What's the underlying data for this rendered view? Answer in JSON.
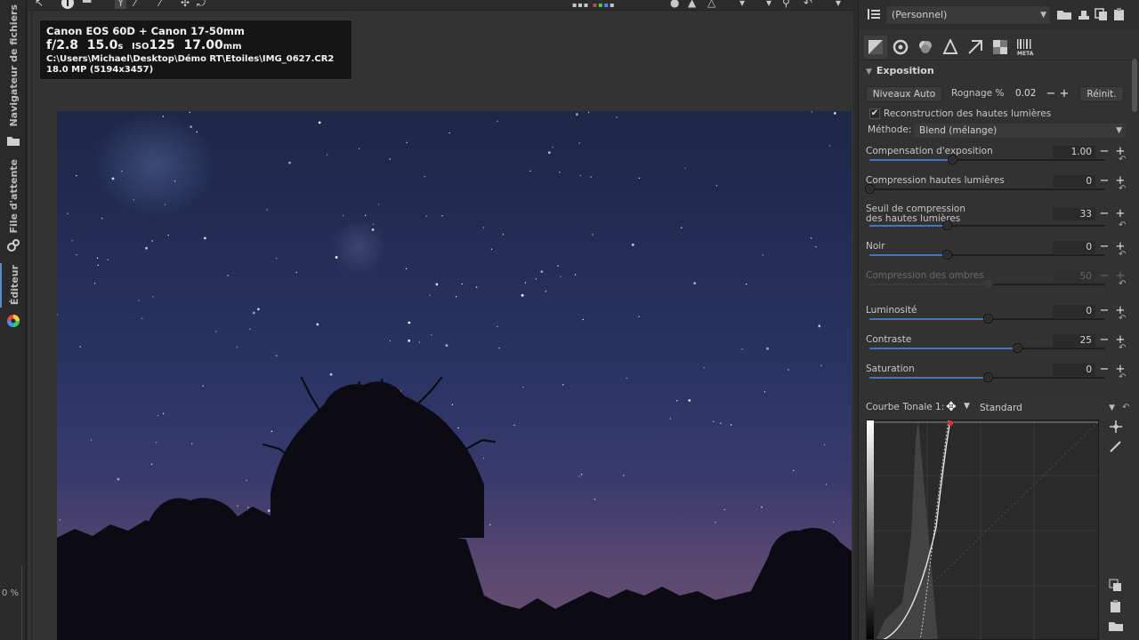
{
  "vtabs": {
    "file_browser": "Navigateur de fichiers",
    "queue": "File d'attente",
    "editor": "Éditeur",
    "zoom": "0 %"
  },
  "photo_info": {
    "camera": "Canon EOS 60D + Canon 17-50mm",
    "aperture": "f/2.8",
    "shutter_value": "15.0",
    "shutter_unit": "s",
    "iso_label": "ISO",
    "iso_value": "125",
    "focal_value": "17.00",
    "focal_unit": "mm",
    "path": "C:\\Users\\Michael\\Desktop\\Démo RT\\Etoiles\\IMG_0627.CR2",
    "size": "18.0 MP (5194x3457)"
  },
  "right_panel": {
    "profile": "(Personnel)",
    "section_title": "Exposition",
    "btn_auto_levels": "Niveaux Auto",
    "clip_label": "Rognage %",
    "clip_value": "0.02",
    "btn_reset": "Réinit.",
    "highlight_recon_label": "Reconstruction des hautes lumières",
    "method_label": "Méthode:",
    "method_value": "Blend (mélange)",
    "sliders": [
      {
        "label": "Compensation d'exposition",
        "value": "1.00",
        "fraction": 0.35,
        "enabled": true
      },
      {
        "label": "Compression hautes lumières",
        "value": "0",
        "fraction": 0.0,
        "enabled": true
      },
      {
        "label": "Seuil de compression",
        "label2": "des hautes lumières",
        "value": "33",
        "fraction": 0.33,
        "enabled": true
      },
      {
        "label": "Noir",
        "value": "0",
        "fraction": 0.33,
        "enabled": true
      },
      {
        "label": "Compression des ombres",
        "value": "50",
        "fraction": 0.5,
        "enabled": false
      },
      {
        "label": "Luminosité",
        "value": "0",
        "fraction": 0.5,
        "enabled": true
      },
      {
        "label": "Contraste",
        "value": "25",
        "fraction": 0.625,
        "enabled": true
      },
      {
        "label": "Saturation",
        "value": "0",
        "fraction": 0.5,
        "enabled": true
      }
    ],
    "curve_label": "Courbe Tonale 1:",
    "curve_type": "Standard"
  },
  "colors": {
    "accent": "#3b78c8",
    "panel_bg": "#323232",
    "editor_bg": "#333333",
    "curve_point": "#e03030"
  },
  "icons": {
    "toolbar": [
      "pointer-icon",
      "info-icon",
      "copy-icon",
      "crop-icon",
      "pick-icon",
      "straighten-icon",
      "transform-icon",
      "color-swatches-icon",
      "warning-icon",
      "arrow-down-icon",
      "undo-icon",
      "redo-icon"
    ],
    "tool_tabs": [
      "exposure-tab-icon",
      "detail-tab-icon",
      "color-tab-icon",
      "advanced-tab-icon",
      "transform-tab-icon",
      "raw-tab-icon",
      "meta-tab-icon"
    ]
  }
}
